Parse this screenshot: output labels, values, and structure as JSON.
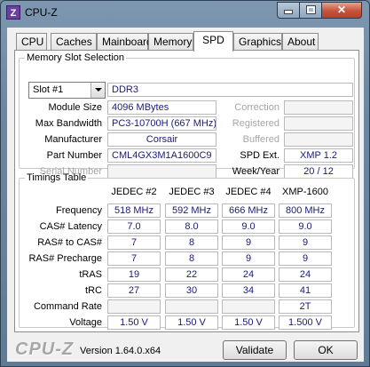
{
  "window": {
    "title": "CPU-Z",
    "icon_label": "Z",
    "minimize_icon": "minimize-icon",
    "maximize_icon": "maximize-icon",
    "close_icon": "close-icon",
    "close_glyph": "✕"
  },
  "tabs": [
    {
      "label": "CPU"
    },
    {
      "label": "Caches"
    },
    {
      "label": "Mainboard"
    },
    {
      "label": "Memory"
    },
    {
      "label": "SPD",
      "active": true
    },
    {
      "label": "Graphics"
    },
    {
      "label": "About"
    }
  ],
  "memory_slot": {
    "legend": "Memory Slot Selection",
    "slot_selected": "Slot #1",
    "type": "DDR3",
    "module_size_label": "Module Size",
    "module_size": "4096 MBytes",
    "max_bandwidth_label": "Max Bandwidth",
    "max_bandwidth": "PC3-10700H (667 MHz)",
    "manufacturer_label": "Manufacturer",
    "manufacturer": "Corsair",
    "part_number_label": "Part Number",
    "part_number": "CML4GX3M1A1600C9",
    "serial_number_label": "Serial Number",
    "serial_number": "",
    "correction_label": "Correction",
    "correction": "",
    "registered_label": "Registered",
    "registered": "",
    "buffered_label": "Buffered",
    "buffered": "",
    "spd_ext_label": "SPD Ext.",
    "spd_ext": "XMP 1.2",
    "week_year_label": "Week/Year",
    "week_year": "20 / 12"
  },
  "timings": {
    "legend": "Timings Table",
    "columns": [
      "JEDEC #2",
      "JEDEC #3",
      "JEDEC #4",
      "XMP-1600"
    ],
    "rows": [
      {
        "label": "Frequency",
        "values": [
          "518 MHz",
          "592 MHz",
          "666 MHz",
          "800 MHz"
        ]
      },
      {
        "label": "CAS# Latency",
        "values": [
          "7.0",
          "8.0",
          "9.0",
          "9.0"
        ]
      },
      {
        "label": "RAS# to CAS#",
        "values": [
          "7",
          "8",
          "9",
          "9"
        ]
      },
      {
        "label": "RAS# Precharge",
        "values": [
          "7",
          "8",
          "9",
          "9"
        ]
      },
      {
        "label": "tRAS",
        "values": [
          "19",
          "22",
          "24",
          "24"
        ]
      },
      {
        "label": "tRC",
        "values": [
          "27",
          "30",
          "34",
          "41"
        ]
      },
      {
        "label": "Command Rate",
        "values": [
          "",
          "",
          "",
          "2T"
        ]
      },
      {
        "label": "Voltage",
        "values": [
          "1.50 V",
          "1.50 V",
          "1.50 V",
          "1.500 V"
        ]
      }
    ]
  },
  "footer": {
    "logo": "CPU-Z",
    "version": "Version 1.64.0.x64",
    "validate_label": "Validate",
    "ok_label": "OK"
  }
}
